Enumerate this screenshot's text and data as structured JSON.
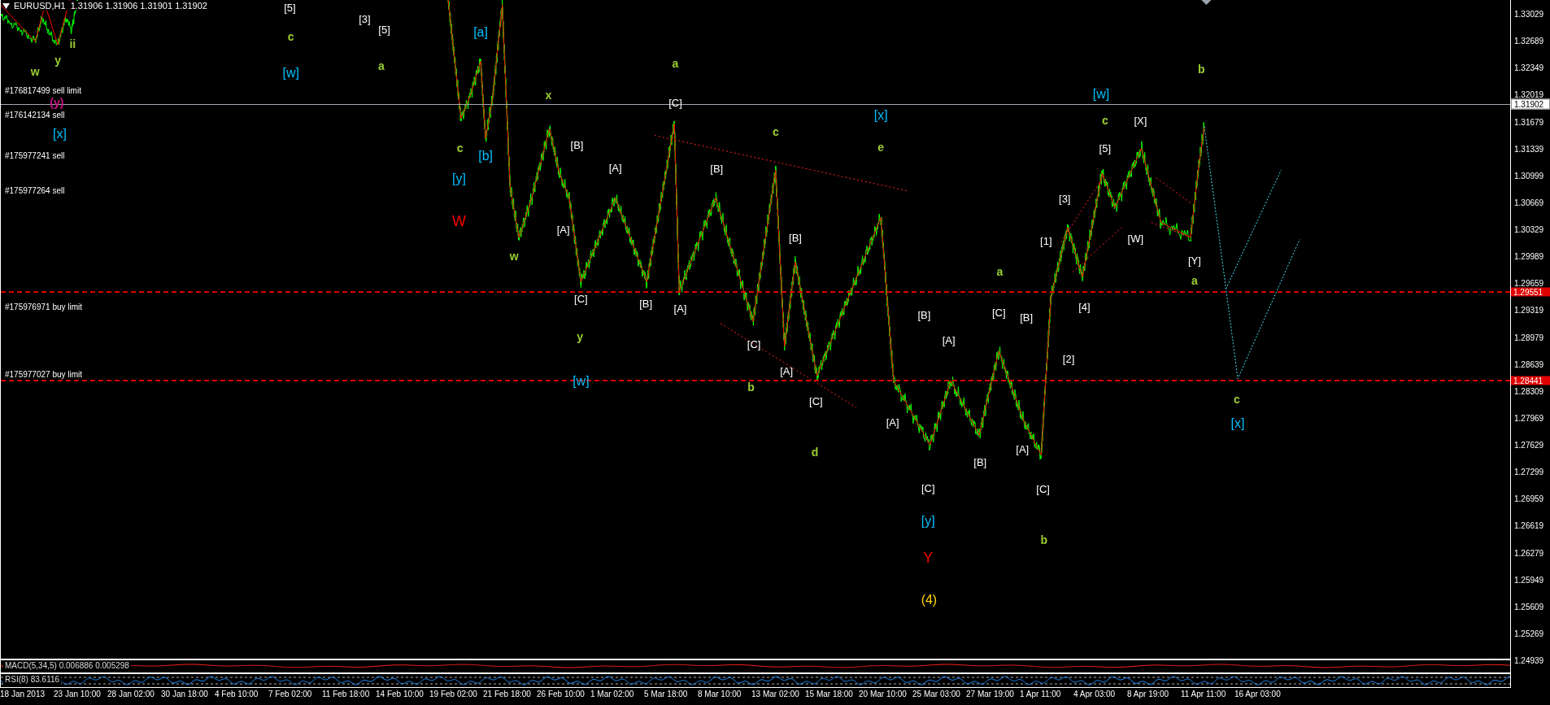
{
  "chart": {
    "header": "EURUSD,H1  1.31906 1.31906 1.31901 1.31902",
    "orders": [
      {
        "label": "#176817499 sell limit"
      },
      {
        "label": "#176142134 sell"
      },
      {
        "label": "#175977241 sell"
      },
      {
        "label": "#175977264 sell"
      },
      {
        "label": "#175976971 buy limit"
      },
      {
        "label": "#175977027 buy limit"
      }
    ],
    "price_levels": [
      {
        "price": "1.31902",
        "kind": "bid"
      },
      {
        "price": "1.29551",
        "kind": "order"
      },
      {
        "price": "1.28441",
        "kind": "order"
      }
    ],
    "wave_labels": [
      {
        "text": "[5]",
        "color": "#ffffff"
      },
      {
        "text": "c",
        "color": "#9acd32"
      },
      {
        "text": "[w]",
        "color": "#00bfff"
      },
      {
        "text": "[3]",
        "color": "#ffffff"
      },
      {
        "text": "[5]",
        "color": "#ffffff"
      },
      {
        "text": "a",
        "color": "#9acd32"
      },
      {
        "text": "w",
        "color": "#9acd32"
      },
      {
        "text": "y",
        "color": "#9acd32"
      },
      {
        "text": "ii",
        "color": "#9acd32"
      },
      {
        "text": "(y)",
        "color": "#c71585"
      },
      {
        "text": "[x]",
        "color": "#00bfff"
      },
      {
        "text": "[a]",
        "color": "#00bfff"
      },
      {
        "text": "c",
        "color": "#9acd32"
      },
      {
        "text": "[b]",
        "color": "#00bfff"
      },
      {
        "text": "[y]",
        "color": "#00bfff"
      },
      {
        "text": "W",
        "color": "#ff0000"
      },
      {
        "text": "w",
        "color": "#9acd32"
      },
      {
        "text": "x",
        "color": "#9acd32"
      },
      {
        "text": "a",
        "color": "#9acd32"
      },
      {
        "text": "[C]",
        "color": "#ffffff"
      },
      {
        "text": "[B]",
        "color": "#ffffff"
      },
      {
        "text": "[A]",
        "color": "#ffffff"
      },
      {
        "text": "[A]",
        "color": "#ffffff"
      },
      {
        "text": "[C]",
        "color": "#ffffff"
      },
      {
        "text": "[B]",
        "color": "#ffffff"
      },
      {
        "text": "[A]",
        "color": "#ffffff"
      },
      {
        "text": "y",
        "color": "#9acd32"
      },
      {
        "text": "[w]",
        "color": "#00bfff"
      },
      {
        "text": "c",
        "color": "#9acd32"
      },
      {
        "text": "[B]",
        "color": "#ffffff"
      },
      {
        "text": "[x]",
        "color": "#00bfff"
      },
      {
        "text": "e",
        "color": "#9acd32"
      },
      {
        "text": "[B]",
        "color": "#ffffff"
      },
      {
        "text": "[C]",
        "color": "#ffffff"
      },
      {
        "text": "b",
        "color": "#9acd32"
      },
      {
        "text": "[A]",
        "color": "#ffffff"
      },
      {
        "text": "[C]",
        "color": "#ffffff"
      },
      {
        "text": "d",
        "color": "#9acd32"
      },
      {
        "text": "[B]",
        "color": "#ffffff"
      },
      {
        "text": "[A]",
        "color": "#ffffff"
      },
      {
        "text": "[A]",
        "color": "#ffffff"
      },
      {
        "text": "[C]",
        "color": "#ffffff"
      },
      {
        "text": "[y]",
        "color": "#00bfff"
      },
      {
        "text": "Y",
        "color": "#ff0000"
      },
      {
        "text": "(4)",
        "color": "#ffd700"
      },
      {
        "text": "a",
        "color": "#9acd32"
      },
      {
        "text": "[C]",
        "color": "#ffffff"
      },
      {
        "text": "[B]",
        "color": "#ffffff"
      },
      {
        "text": "[B]",
        "color": "#ffffff"
      },
      {
        "text": "[1]",
        "color": "#ffffff"
      },
      {
        "text": "[A]",
        "color": "#ffffff"
      },
      {
        "text": "[C]",
        "color": "#ffffff"
      },
      {
        "text": "b",
        "color": "#9acd32"
      },
      {
        "text": "[3]",
        "color": "#ffffff"
      },
      {
        "text": "[4]",
        "color": "#ffffff"
      },
      {
        "text": "[2]",
        "color": "#ffffff"
      },
      {
        "text": "[w]",
        "color": "#00bfff"
      },
      {
        "text": "c",
        "color": "#9acd32"
      },
      {
        "text": "[5]",
        "color": "#ffffff"
      },
      {
        "text": "[X]",
        "color": "#ffffff"
      },
      {
        "text": "[W]",
        "color": "#ffffff"
      },
      {
        "text": "[Y]",
        "color": "#ffffff"
      },
      {
        "text": "a",
        "color": "#9acd32"
      },
      {
        "text": "b",
        "color": "#9acd32"
      },
      {
        "text": "c",
        "color": "#9acd32"
      },
      {
        "text": "[x]",
        "color": "#00bfff"
      }
    ],
    "price_axis": [
      "1.33029",
      "1.32689",
      "1.32349",
      "1.32019",
      "1.31679",
      "1.31339",
      "1.30999",
      "1.30669",
      "1.30329",
      "1.29989",
      "1.29659",
      "1.29319",
      "1.28979",
      "1.28639",
      "1.28309",
      "1.27969",
      "1.27629",
      "1.27299",
      "1.26959",
      "1.26619",
      "1.26279",
      "1.25949",
      "1.25609",
      "1.25269",
      "1.24939"
    ],
    "time_axis": [
      "18 Jan 2013",
      "23 Jan 10:00",
      "28 Jan 02:00",
      "30 Jan 18:00",
      "4 Feb 10:00",
      "7 Feb 02:00",
      "11 Feb 18:00",
      "14 Feb 10:00",
      "19 Feb 02:00",
      "21 Feb 18:00",
      "26 Feb 10:00",
      "1 Mar 02:00",
      "5 Mar 18:00",
      "8 Mar 10:00",
      "13 Mar 02:00",
      "15 Mar 18:00",
      "20 Mar 10:00",
      "25 Mar 03:00",
      "27 Mar 19:00",
      "1 Apr 11:00",
      "4 Apr 03:00",
      "8 Apr 19:00",
      "11 Apr 11:00",
      "16 Apr 03:00"
    ]
  },
  "indicators": [
    {
      "kind": "macd",
      "label": "MACD(5,34,5) 0.006886 0.005298"
    },
    {
      "kind": "rsi",
      "label": "RSI(8) 83.6116"
    }
  ]
}
